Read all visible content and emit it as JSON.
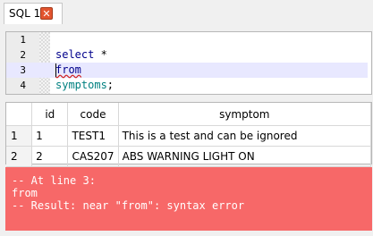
{
  "tab": {
    "label": "SQL 1",
    "close_glyph": "✕"
  },
  "editor": {
    "lines": [
      {
        "num": "1",
        "text": ""
      },
      {
        "num": "2",
        "text": "select *"
      },
      {
        "num": "3",
        "text": "from"
      },
      {
        "num": "4",
        "text": "symptoms;"
      }
    ],
    "tokens": {
      "select": "select",
      "star": "*",
      "from": "from",
      "table": "symptoms",
      "semicolon": ";"
    }
  },
  "results": {
    "columns": [
      "",
      "id",
      "code",
      "symptom"
    ],
    "rows": [
      {
        "rownum": "1",
        "id": "1",
        "code": "TEST1",
        "symptom": "This is a test and can be ignored"
      },
      {
        "rownum": "2",
        "id": "2",
        "code": "CAS207",
        "symptom": "ABS WARNING LIGHT ON"
      }
    ]
  },
  "messages": {
    "lines": [
      "-- At line 3:",
      "from",
      "-- Result: near \"from\": syntax error"
    ],
    "background_color": "#f76868"
  },
  "colors": {
    "keyword": "#00008b",
    "identifier": "#008080",
    "current_line": "#e8e8ff",
    "tab_close": "#e2542f"
  }
}
